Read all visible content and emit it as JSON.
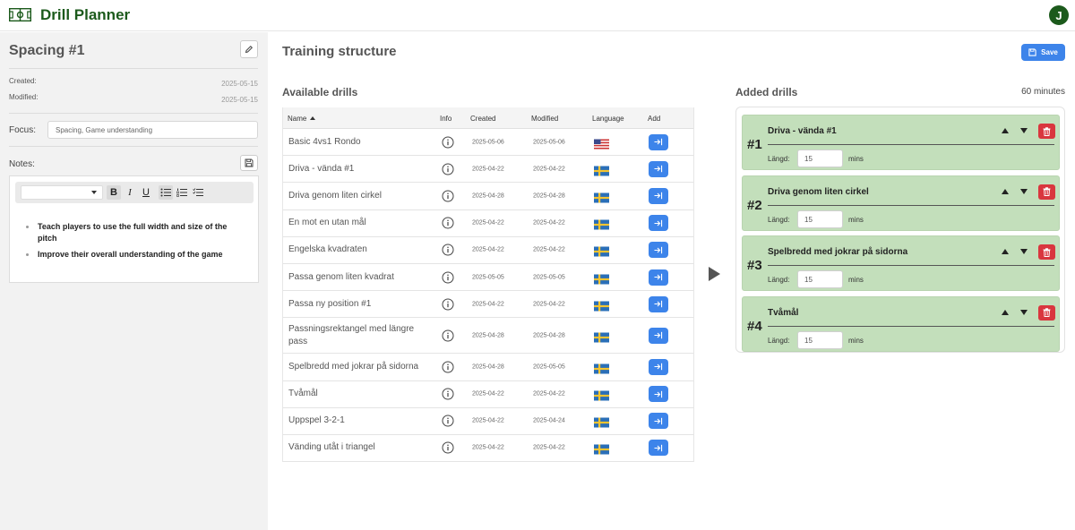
{
  "app": {
    "title": "Drill Planner",
    "avatar_letter": "J",
    "logo_icon": "soccer-field-icon"
  },
  "sidebar": {
    "session_title": "Spacing #1",
    "created_label": "Created:",
    "created_value": "2025-05-15",
    "modified_label": "Modified:",
    "modified_value": "2025-05-15",
    "focus_label": "Focus:",
    "focus_value": "Spacing, Game understanding",
    "notes_label": "Notes:",
    "notes_items": [
      "Teach players to use the full width and size of the pitch",
      "Improve their overall understanding of the game"
    ]
  },
  "main": {
    "title": "Training structure",
    "save_label": "Save"
  },
  "available": {
    "title": "Available drills",
    "columns": [
      "Name",
      "Info",
      "Created",
      "Modified",
      "Language",
      "Add"
    ],
    "rows": [
      {
        "name": "Basic 4vs1 Rondo",
        "created": "2025-05-06",
        "modified": "2025-05-06",
        "language": "us"
      },
      {
        "name": "Driva - vända #1",
        "created": "2025-04-22",
        "modified": "2025-04-22",
        "language": "se"
      },
      {
        "name": "Driva genom liten cirkel",
        "created": "2025-04-28",
        "modified": "2025-04-28",
        "language": "se"
      },
      {
        "name": "En mot en utan mål",
        "created": "2025-04-22",
        "modified": "2025-04-22",
        "language": "se"
      },
      {
        "name": "Engelska kvadraten",
        "created": "2025-04-22",
        "modified": "2025-04-22",
        "language": "se"
      },
      {
        "name": "Passa genom liten kvadrat",
        "created": "2025-05-05",
        "modified": "2025-05-05",
        "language": "se"
      },
      {
        "name": "Passa ny position #1",
        "created": "2025-04-22",
        "modified": "2025-04-22",
        "language": "se"
      },
      {
        "name": "Passningsrektangel med längre pass",
        "created": "2025-04-28",
        "modified": "2025-04-28",
        "language": "se"
      },
      {
        "name": "Spelbredd med jokrar på sidorna",
        "created": "2025-04-28",
        "modified": "2025-05-05",
        "language": "se"
      },
      {
        "name": "Tvåmål",
        "created": "2025-04-22",
        "modified": "2025-04-22",
        "language": "se"
      },
      {
        "name": "Uppspel 3-2-1",
        "created": "2025-04-22",
        "modified": "2025-04-24",
        "language": "se"
      },
      {
        "name": "Vänding utåt i triangel",
        "created": "2025-04-22",
        "modified": "2025-04-22",
        "language": "se"
      }
    ]
  },
  "added": {
    "title": "Added drills",
    "total": "60 minutes",
    "length_label": "Längd:",
    "unit": "mins",
    "drills": [
      {
        "num": "#1",
        "name": "Driva - vända #1",
        "length": "15"
      },
      {
        "num": "#2",
        "name": "Driva genom liten cirkel",
        "length": "15"
      },
      {
        "num": "#3",
        "name": "Spelbredd med jokrar på sidorna",
        "length": "15"
      },
      {
        "num": "#4",
        "name": "Tvåmål",
        "length": "15"
      }
    ]
  },
  "colors": {
    "brand": "#1c5a1c",
    "primary": "#3d84ea",
    "card": "#c3dfbb",
    "danger": "#d9363e"
  }
}
